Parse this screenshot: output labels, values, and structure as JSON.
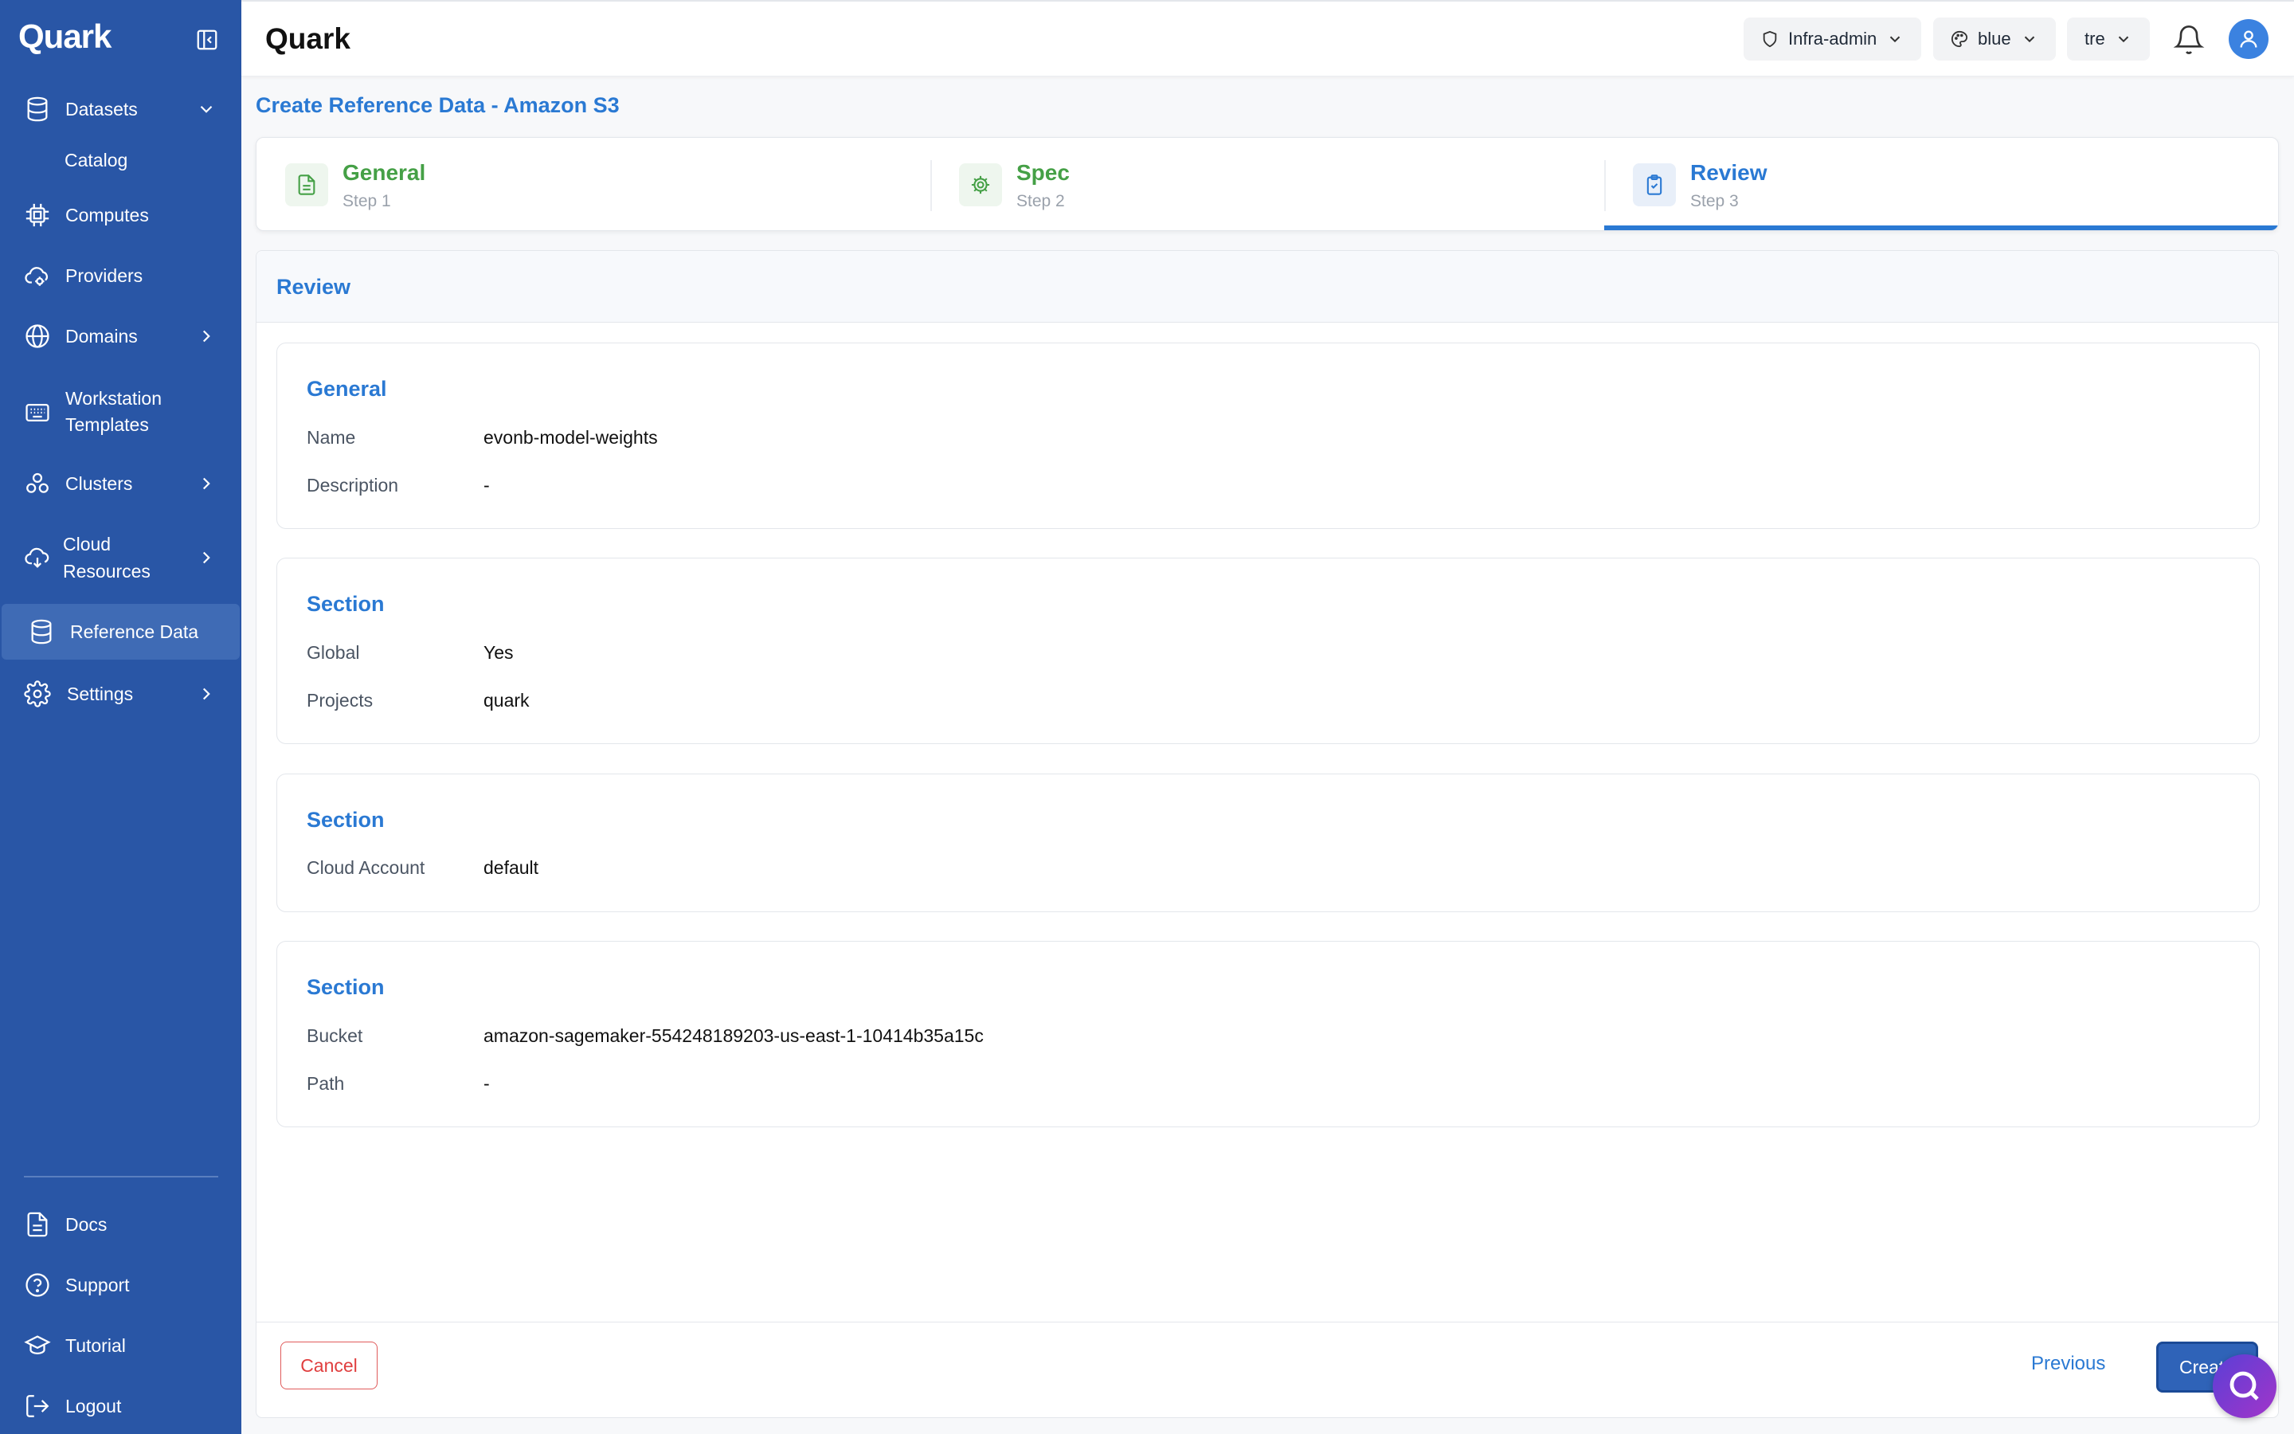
{
  "sidebar": {
    "logo": "Quark",
    "items": [
      {
        "label": "Datasets",
        "icon": "database-icon"
      },
      {
        "label": "Catalog"
      },
      {
        "label": "Computes",
        "icon": "chip-icon"
      },
      {
        "label": "Providers",
        "icon": "cloud-gear-icon"
      },
      {
        "label": "Domains",
        "icon": "globe-icon"
      },
      {
        "label": "Workstation Templates",
        "label_line1": "Workstation",
        "label_line2": "Templates",
        "icon": "keyboard-icon"
      },
      {
        "label": "Clusters",
        "icon": "cluster-icon"
      },
      {
        "label": "Cloud Resources",
        "label_line1": "Cloud",
        "label_line2": "Resources",
        "icon": "cloud-download-icon"
      },
      {
        "label": "Reference Data",
        "icon": "database-icon"
      },
      {
        "label": "Settings",
        "icon": "gear-icon"
      }
    ],
    "bottom": [
      {
        "label": "Docs",
        "icon": "document-icon"
      },
      {
        "label": "Support",
        "icon": "help-circle-icon"
      },
      {
        "label": "Tutorial",
        "icon": "graduation-cap-icon"
      },
      {
        "label": "Logout",
        "icon": "logout-icon"
      }
    ]
  },
  "header": {
    "title": "Quark",
    "role": "Infra-admin",
    "theme": "blue",
    "user": "tre"
  },
  "page": {
    "title": "Create Reference Data - Amazon S3",
    "steps": [
      {
        "name": "General",
        "sub": "Step 1",
        "state": "done"
      },
      {
        "name": "Spec",
        "sub": "Step 2",
        "state": "done"
      },
      {
        "name": "Review",
        "sub": "Step 3",
        "state": "current"
      }
    ],
    "review_title": "Review",
    "cards": [
      {
        "title": "General",
        "rows": [
          {
            "label": "Name",
            "value": "evonb-model-weights"
          },
          {
            "label": "Description",
            "value": "-"
          }
        ]
      },
      {
        "title": "Section",
        "rows": [
          {
            "label": "Global",
            "value": "Yes"
          },
          {
            "label": "Projects",
            "value": "quark"
          }
        ]
      },
      {
        "title": "Section",
        "rows": [
          {
            "label": "Cloud Account",
            "value": "default"
          }
        ]
      },
      {
        "title": "Section",
        "rows": [
          {
            "label": "Bucket",
            "value": "amazon-sagemaker-554248189203-us-east-1-10414b35a15c"
          },
          {
            "label": "Path",
            "value": "-"
          }
        ]
      }
    ],
    "buttons": {
      "cancel": "Cancel",
      "previous": "Previous",
      "create": "Create"
    }
  },
  "colors": {
    "sidebar": "#2956a6",
    "accent": "#2a79d3",
    "success": "#45a046",
    "danger": "#e03e3e"
  }
}
